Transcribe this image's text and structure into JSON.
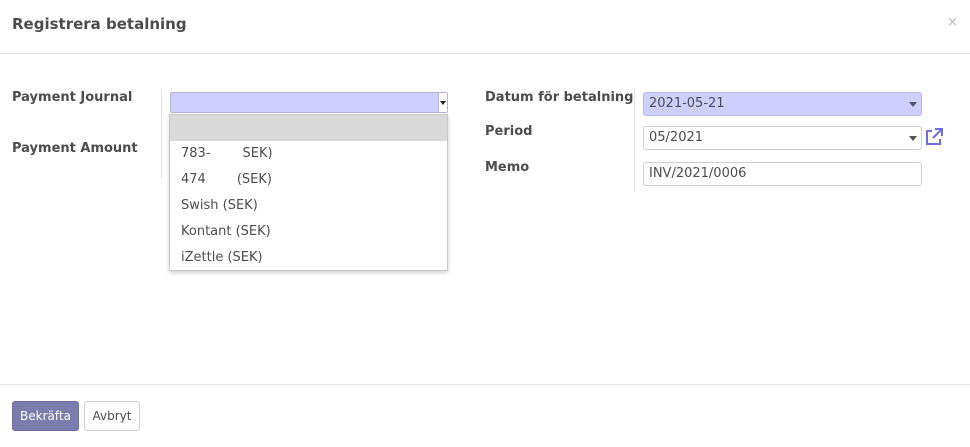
{
  "dialog": {
    "title": "Registrera betalning",
    "close_glyph": "×"
  },
  "left": {
    "payment_journal_label": "Payment Journal",
    "payment_amount_label": "Payment Amount",
    "journal_value": "",
    "journal_options": [
      {
        "prefix": "",
        "suffix": ""
      },
      {
        "prefix": "783-",
        "suffix": "SEK)"
      },
      {
        "prefix": "474",
        "suffix": "(SEK)"
      },
      {
        "prefix": "Swish (SEK)",
        "suffix": ""
      },
      {
        "prefix": "Kontant (SEK)",
        "suffix": ""
      },
      {
        "prefix": "iZettle (SEK)",
        "suffix": ""
      }
    ]
  },
  "right": {
    "date_label": "Datum för betalning",
    "date_value": "2021-05-21",
    "period_label": "Period",
    "period_value": "05/2021",
    "memo_label": "Memo",
    "memo_value": "INV/2021/0006"
  },
  "footer": {
    "confirm_label": "Bekräfta",
    "cancel_label": "Avbryt"
  },
  "colors": {
    "primary": "#7c7bad",
    "required_field": "#cfcfff",
    "open_link_icon": "#6d6ce0"
  },
  "icons": {
    "close": "close-icon",
    "external_link": "external-link-icon"
  }
}
